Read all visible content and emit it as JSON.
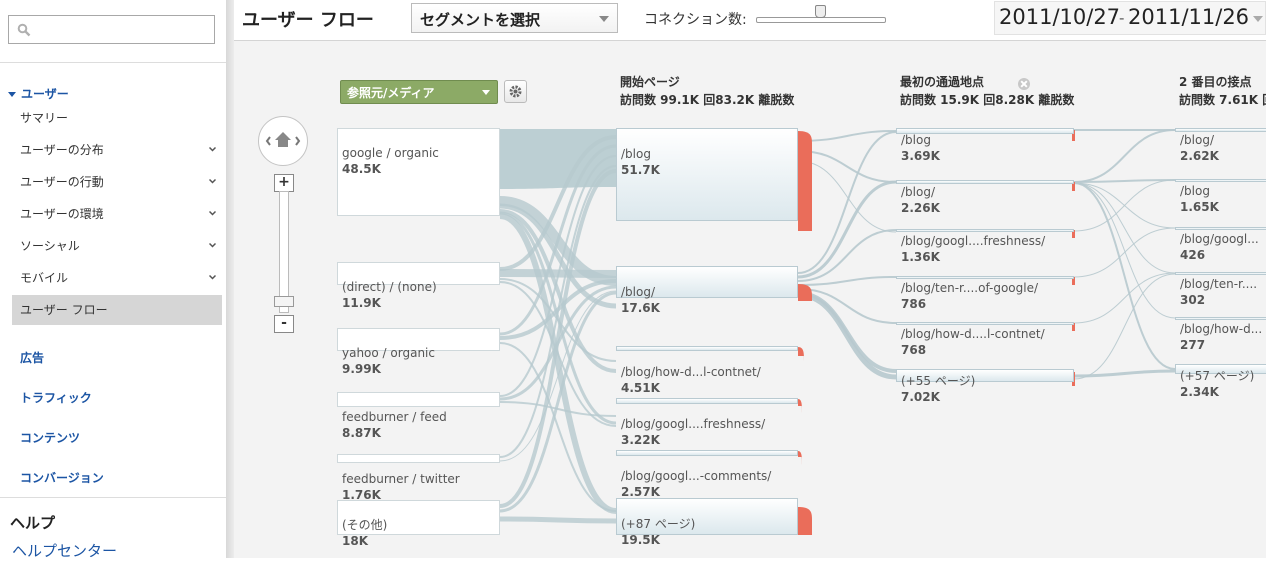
{
  "sidebar": {
    "search_placeholder": "",
    "section_users": "ユーザー",
    "items": [
      {
        "label": "サマリー",
        "chevron": false,
        "active": false
      },
      {
        "label": "ユーザーの分布",
        "chevron": true,
        "active": false
      },
      {
        "label": "ユーザーの行動",
        "chevron": true,
        "active": false
      },
      {
        "label": "ユーザーの環境",
        "chevron": true,
        "active": false
      },
      {
        "label": "ソーシャル",
        "chevron": true,
        "active": false
      },
      {
        "label": "モバイル",
        "chevron": true,
        "active": false
      },
      {
        "label": "ユーザー フロー",
        "chevron": false,
        "active": true
      }
    ],
    "sections": [
      "広告",
      "トラフィック",
      "コンテンツ",
      "コンバージョン"
    ],
    "help_title": "ヘルプ",
    "help_center": "ヘルプセンター"
  },
  "header": {
    "title": "ユーザー フロー",
    "segment_label": "セグメントを選択",
    "connection_label": "コネクション数:",
    "date_start": "2011/10/27",
    "date_sep": "-",
    "date_end": "2011/11/26"
  },
  "flow": {
    "dimension_label": "参照元/メディア",
    "columns": [
      {
        "title": "開始ページ",
        "stats": "訪問数 99.1K 回83.2K 離脱数"
      },
      {
        "title": "最初の通過地点",
        "stats": "訪問数 15.9K 回8.28K 離脱数"
      },
      {
        "title": "2 番目の接点",
        "stats": "訪問数 7.61K 回"
      }
    ],
    "sources": [
      {
        "name": "google / organic",
        "value": "48.5K"
      },
      {
        "name": "(direct) / (none)",
        "value": "11.9K"
      },
      {
        "name": "yahoo / organic",
        "value": "9.99K"
      },
      {
        "name": "feedburner / feed",
        "value": "8.87K"
      },
      {
        "name": "feedburner / twitter",
        "value": "1.76K"
      },
      {
        "name": "(その他)",
        "value": "18K"
      }
    ],
    "start_pages": [
      {
        "name": "/blog",
        "value": "51.7K"
      },
      {
        "name": "/blog/",
        "value": "17.6K"
      },
      {
        "name": "/blog/how-d...l-contnet/",
        "value": "4.51K"
      },
      {
        "name": "/blog/googl....freshness/",
        "value": "3.22K"
      },
      {
        "name": "/blog/googl...-comments/",
        "value": "2.57K"
      },
      {
        "name": "(+87 ページ)",
        "value": "19.5K"
      }
    ],
    "first_interactions": [
      {
        "name": "/blog",
        "value": "3.69K"
      },
      {
        "name": "/blog/",
        "value": "2.26K"
      },
      {
        "name": "/blog/googl....freshness/",
        "value": "1.36K"
      },
      {
        "name": "/blog/ten-r....of-google/",
        "value": "786"
      },
      {
        "name": "/blog/how-d....l-contnet/",
        "value": "768"
      },
      {
        "name": "(+55 ページ)",
        "value": "7.02K"
      }
    ],
    "second_interactions": [
      {
        "name": "/blog/",
        "value": "2.62K"
      },
      {
        "name": "/blog",
        "value": "1.65K"
      },
      {
        "name": "/blog/googl...",
        "value": "426"
      },
      {
        "name": "/blog/ten-r....",
        "value": "302"
      },
      {
        "name": "/blog/how-d...",
        "value": "277"
      },
      {
        "name": "(+57 ページ)",
        "value": "2.34K"
      }
    ]
  }
}
